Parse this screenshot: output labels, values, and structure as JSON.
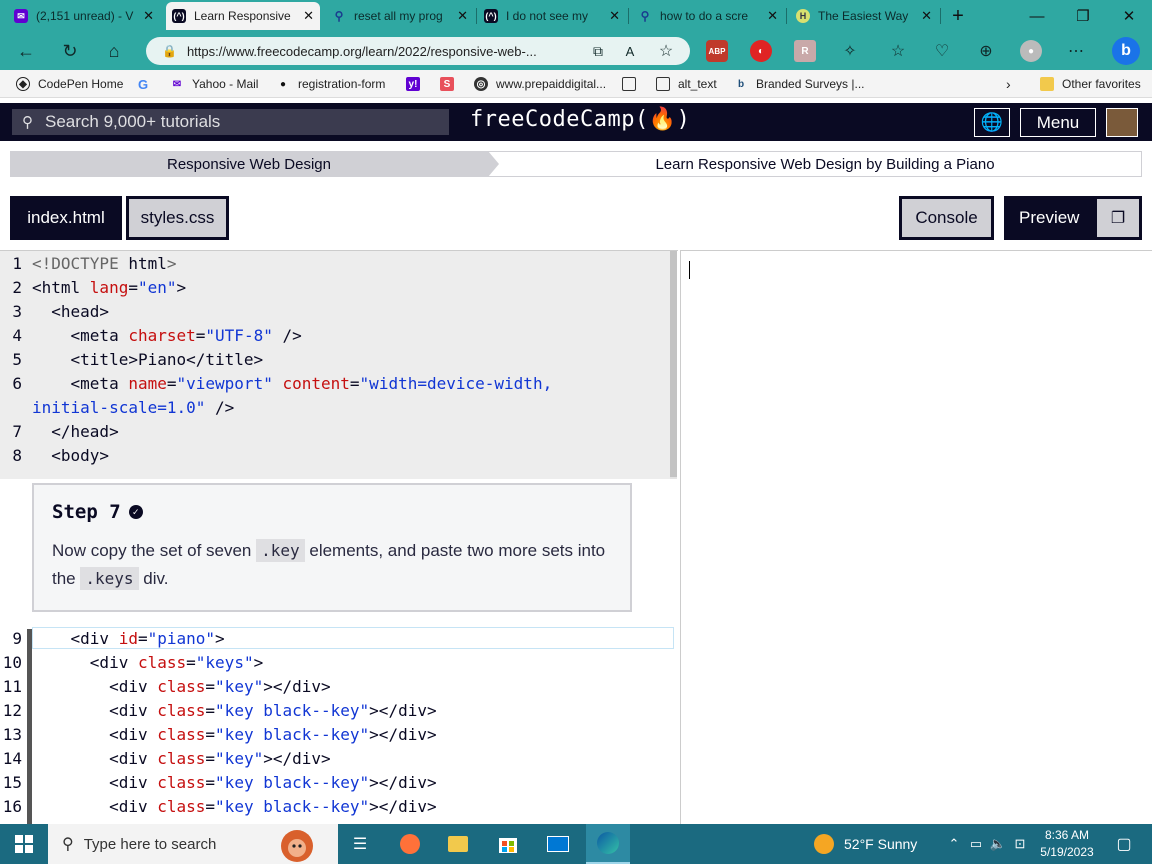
{
  "browser": {
    "tabs": [
      {
        "title": "(2,151 unread) - V",
        "icon": "yahoo-mail-icon"
      },
      {
        "title": "Learn Responsive",
        "icon": "freecodecamp-icon"
      },
      {
        "title": "reset all my prog",
        "icon": "search-icon"
      },
      {
        "title": "I do not see my",
        "icon": "freecodecamp-icon"
      },
      {
        "title": "how to do a scre",
        "icon": "search-icon"
      },
      {
        "title": "The Easiest Way",
        "icon": "website-icon"
      }
    ],
    "url": "https://www.freecodecamp.org/learn/2022/responsive-web-...",
    "bookmarks": [
      {
        "label": "CodePen Home"
      },
      {
        "label": "Yahoo - Mail"
      },
      {
        "label": "registration-form"
      },
      {
        "label": "www.prepaiddigital..."
      },
      {
        "label": "alt_text"
      },
      {
        "label": "Branded Surveys |..."
      }
    ],
    "other_favorites": "Other favorites",
    "extension_labels": {
      "abp": "ABP"
    }
  },
  "fcc": {
    "search_placeholder": "Search 9,000+ tutorials",
    "logo": "freeCodeCamp(🔥)",
    "menu_label": "Menu"
  },
  "breadcrumb": {
    "superblock": "Responsive Web Design",
    "block": "Learn Responsive Web Design by Building a Piano"
  },
  "editor": {
    "file_tabs": [
      "index.html",
      "styles.css"
    ],
    "console_label": "Console",
    "preview_label": "Preview",
    "line_numbers_top": [
      "1",
      "2",
      "3",
      "4",
      "5",
      "6",
      "7",
      "8"
    ],
    "line_numbers_bottom": [
      "9",
      "10",
      "11",
      "12",
      "13",
      "14",
      "15",
      "16"
    ]
  },
  "step": {
    "title": "Step 7",
    "text_before": "Now copy the set of seven ",
    "code1": ".key",
    "text_middle": " elements, and paste two more sets into the ",
    "code2": ".keys",
    "text_after": " div."
  },
  "taskbar": {
    "search_placeholder": "Type here to search",
    "weather": "52°F  Sunny",
    "time": "8:36 AM",
    "date": "5/19/2023"
  },
  "colors": {
    "browser_accent": "#2fa8a2",
    "fcc_dark": "#0a0a23",
    "code_attr": "#c50f0f",
    "code_string": "#1136d4",
    "taskbar": "#1b6a80"
  }
}
